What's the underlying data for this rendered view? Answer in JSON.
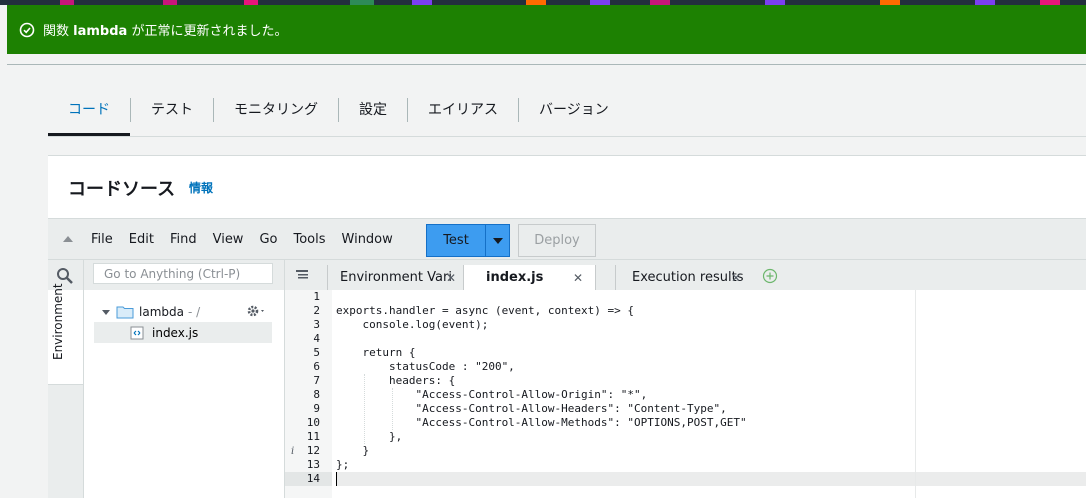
{
  "flash": {
    "prefix": "関数 ",
    "function_name": "lambda",
    "suffix": " が正常に更新されました。"
  },
  "tabs": [
    {
      "label": "コード",
      "active": true
    },
    {
      "label": "テスト",
      "active": false
    },
    {
      "label": "モニタリング",
      "active": false
    },
    {
      "label": "設定",
      "active": false
    },
    {
      "label": "エイリアス",
      "active": false
    },
    {
      "label": "バージョン",
      "active": false
    }
  ],
  "code_source": {
    "title": "コードソース",
    "info_link": "情報"
  },
  "ide": {
    "menu": [
      "File",
      "Edit",
      "Find",
      "View",
      "Go",
      "Tools",
      "Window"
    ],
    "test_button": "Test",
    "deploy_button": "Deploy",
    "goto_placeholder": "Go to Anything (Ctrl-P)",
    "environment_tab": "Environment",
    "tree": {
      "root": "lambda",
      "root_suffix": "- /",
      "file": "index.js"
    },
    "editor_tabs": [
      {
        "label": "Environment Vari",
        "active": false
      },
      {
        "label": "index.js",
        "active": true
      },
      {
        "label": "Execution results",
        "active": false
      }
    ],
    "line_numbers": [
      "1",
      "2",
      "3",
      "4",
      "5",
      "6",
      "7",
      "8",
      "9",
      "10",
      "11",
      "12",
      "13",
      "14"
    ],
    "code_lines": [
      "",
      "exports.handler = async (event, context) => {",
      "    console.log(event);",
      "",
      "    return {",
      "        statusCode : \"200\",",
      "        headers: {",
      "            \"Access-Control-Allow-Origin\": \"*\",",
      "            \"Access-Control-Allow-Headers\": \"Content-Type\",",
      "            \"Access-Control-Allow-Methods\": \"OPTIONS,POST,GET\"",
      "        },",
      "    }",
      "};",
      ""
    ],
    "cursor_line": 14
  },
  "colors": {
    "flash_bg": "#1d8102",
    "accent": "#0073bb",
    "test_button": "#3d9cf0"
  }
}
